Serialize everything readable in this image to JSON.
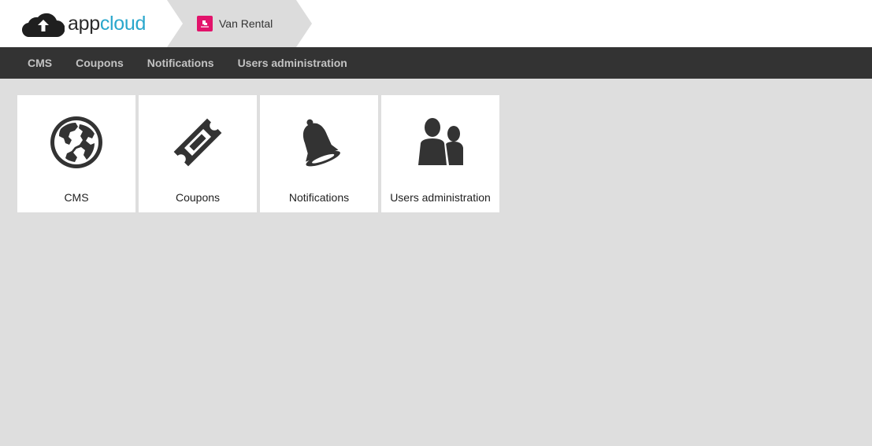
{
  "header": {
    "logo": {
      "part1": "app",
      "part2": "cloud",
      "icon": "cloud-upload-icon"
    },
    "breadcrumb": {
      "label": "Van Rental",
      "badge_icon": "app-badge-icon"
    }
  },
  "nav": {
    "items": [
      {
        "label": "CMS"
      },
      {
        "label": "Coupons"
      },
      {
        "label": "Notifications"
      },
      {
        "label": "Users administration"
      }
    ]
  },
  "tiles": [
    {
      "label": "CMS",
      "icon": "globe-icon"
    },
    {
      "label": "Coupons",
      "icon": "ticket-icon"
    },
    {
      "label": "Notifications",
      "icon": "bell-icon"
    },
    {
      "label": "Users administration",
      "icon": "users-icon"
    }
  ],
  "colors": {
    "brand_accent": "#29a7cc",
    "badge": "#e2136b",
    "navbar": "#333333",
    "nav_text": "#c3c3c3",
    "page_bg": "#dedede",
    "icon": "#333333"
  }
}
